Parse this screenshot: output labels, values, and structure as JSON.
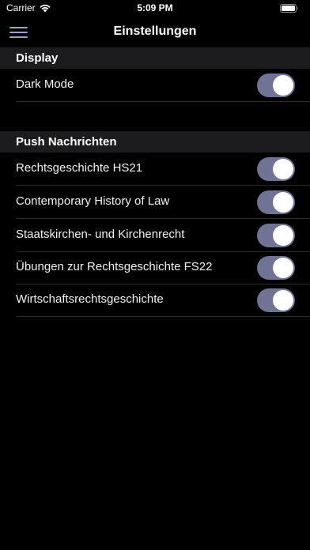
{
  "status_bar": {
    "carrier": "Carrier",
    "time": "5:09 PM"
  },
  "nav": {
    "title": "Einstellungen",
    "menu_icon": "hamburger-menu-icon"
  },
  "sections": {
    "display": {
      "header": "Display",
      "items": [
        {
          "label": "Dark Mode",
          "on": true
        }
      ]
    },
    "push": {
      "header": "Push Nachrichten",
      "items": [
        {
          "label": "Rechtsgeschichte HS21",
          "on": true
        },
        {
          "label": "Contemporary History of Law",
          "on": true
        },
        {
          "label": "Staatskirchen- und Kirchenrecht",
          "on": true
        },
        {
          "label": "Übungen zur Rechtsgeschichte FS22",
          "on": true
        },
        {
          "label": "Wirtschaftsrechtsgeschichte",
          "on": true
        }
      ]
    }
  },
  "colors": {
    "background": "#000000",
    "section_header_bg": "#1c1c1e",
    "toggle_on": "#6f7396",
    "menu_icon": "#9aa4c9"
  }
}
